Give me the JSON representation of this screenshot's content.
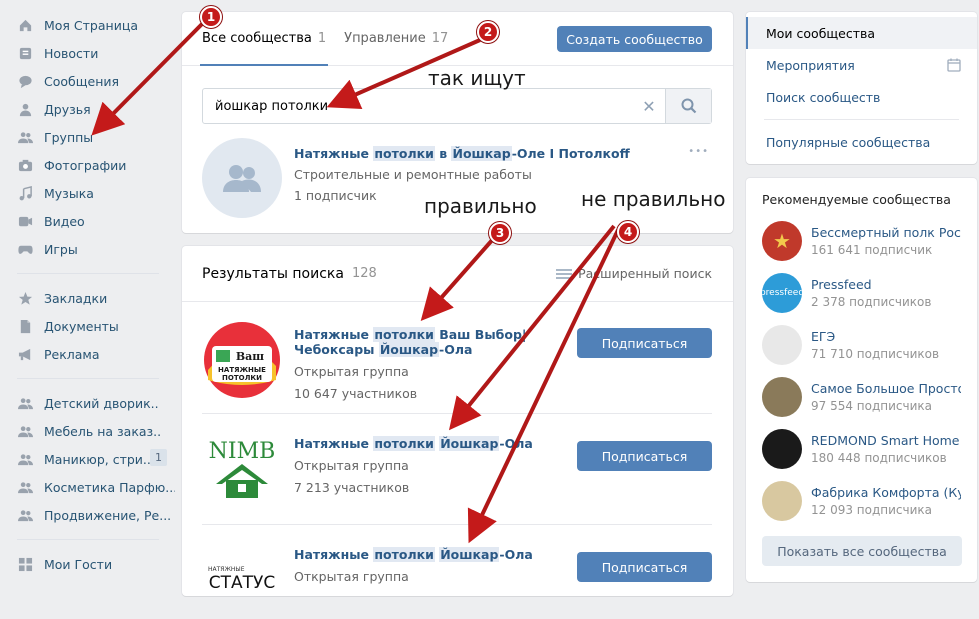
{
  "sidebar": {
    "items": [
      {
        "label": "Моя Страница",
        "icon": "home-icon"
      },
      {
        "label": "Новости",
        "icon": "news-icon"
      },
      {
        "label": "Сообщения",
        "icon": "messages-icon"
      },
      {
        "label": "Друзья",
        "icon": "friends-icon"
      },
      {
        "label": "Группы",
        "icon": "groups-icon"
      },
      {
        "label": "Фотографии",
        "icon": "camera-icon"
      },
      {
        "label": "Музыка",
        "icon": "music-icon"
      },
      {
        "label": "Видео",
        "icon": "video-icon"
      },
      {
        "label": "Игры",
        "icon": "games-icon"
      }
    ],
    "items2": [
      {
        "label": "Закладки",
        "icon": "star-icon"
      },
      {
        "label": "Документы",
        "icon": "document-icon"
      },
      {
        "label": "Реклама",
        "icon": "megaphone-icon"
      }
    ],
    "items3": [
      {
        "label": "Детский дворик..",
        "icon": "community-icon",
        "count": ""
      },
      {
        "label": "Мебель на заказ..",
        "icon": "community-icon",
        "count": ""
      },
      {
        "label": "Маникюр, стри...",
        "icon": "community-icon",
        "count": "1"
      },
      {
        "label": "Косметика Парфю...",
        "icon": "community-icon",
        "count": ""
      },
      {
        "label": "Продвижение, Ре...",
        "icon": "community-icon",
        "count": ""
      }
    ],
    "items4": [
      {
        "label": "Мои Гости",
        "icon": "grid-icon"
      }
    ]
  },
  "tabs": {
    "all_label": "Все сообщества",
    "all_count": "1",
    "manage_label": "Управление",
    "manage_count": "17",
    "create_button": "Создать сообщество"
  },
  "search": {
    "value": "йошкар потолки",
    "clear": "✕"
  },
  "top_result": {
    "name_parts": [
      "Натяжные ",
      "потолки",
      " в ",
      "Йошкар",
      "-Оле I Потолкoff"
    ],
    "category": "Строительные и ремонтные работы",
    "subscribers": "1 подписчик",
    "more": "•••"
  },
  "results": {
    "title": "Результаты поиска",
    "count": "128",
    "advanced": "Расширенный поиск",
    "subscribe_label": "Подписаться",
    "items": [
      {
        "name_parts": [
          "Натяжные ",
          "потолки",
          " Ваш Выбор|Чебоксары ",
          "Йошкар",
          "-Ола"
        ],
        "type": "Открытая группа",
        "members": "10 647 участников",
        "logo": "Ваш выбор натяжные потолки"
      },
      {
        "name_parts": [
          "Натяжные ",
          "потолки",
          " ",
          "Йошкар",
          "-Ола"
        ],
        "type": "Открытая группа",
        "members": "7 213 участников",
        "logo": "NIMB"
      },
      {
        "name_parts": [
          "Натяжные ",
          "потолки",
          " ",
          "Йошкар",
          "-Ола"
        ],
        "type": "Открытая группа",
        "members": "",
        "logo_small": "НАТЯЖНЫЕ",
        "logo": "СТАТУС"
      }
    ]
  },
  "rightnav": {
    "items": [
      "Мои сообщества",
      "Мероприятия",
      "Поиск сообществ",
      "Популярные сообщества"
    ]
  },
  "recommended": {
    "title": "Рекомендуемые сообщества",
    "items": [
      {
        "name": "Бессмертный полк Росс...",
        "subs": "161 641 подписчик",
        "color": "#c0392b",
        "logo": "★"
      },
      {
        "name": "Pressfeed",
        "subs": "2 378 подписчиков",
        "color": "#2d9cd8",
        "logo": "pressfeed"
      },
      {
        "name": "ЕГЭ",
        "subs": "71 710 подписчиков",
        "color": "#e8e8e8",
        "logo": ""
      },
      {
        "name": "Самое Большое Простое...",
        "subs": "97 554 подписчика",
        "color": "#8a7a5a",
        "logo": ""
      },
      {
        "name": "REDMOND Smart Home",
        "subs": "180 448 подписчиков",
        "color": "#1a1a1a",
        "logo": ""
      },
      {
        "name": "Фабрика Комфорта (Кух...",
        "subs": "12 093 подписчика",
        "color": "#d8c8a0",
        "logo": ""
      }
    ],
    "show_all": "Показать все сообщества"
  },
  "annotations": {
    "search_note": "так ищут",
    "correct": "правильно",
    "incorrect": "не правильно",
    "badges": [
      "1",
      "2",
      "3",
      "4"
    ]
  },
  "colors": {
    "accent": "#5181b8",
    "link": "#2a5885",
    "arrow": "#c41a1a"
  }
}
